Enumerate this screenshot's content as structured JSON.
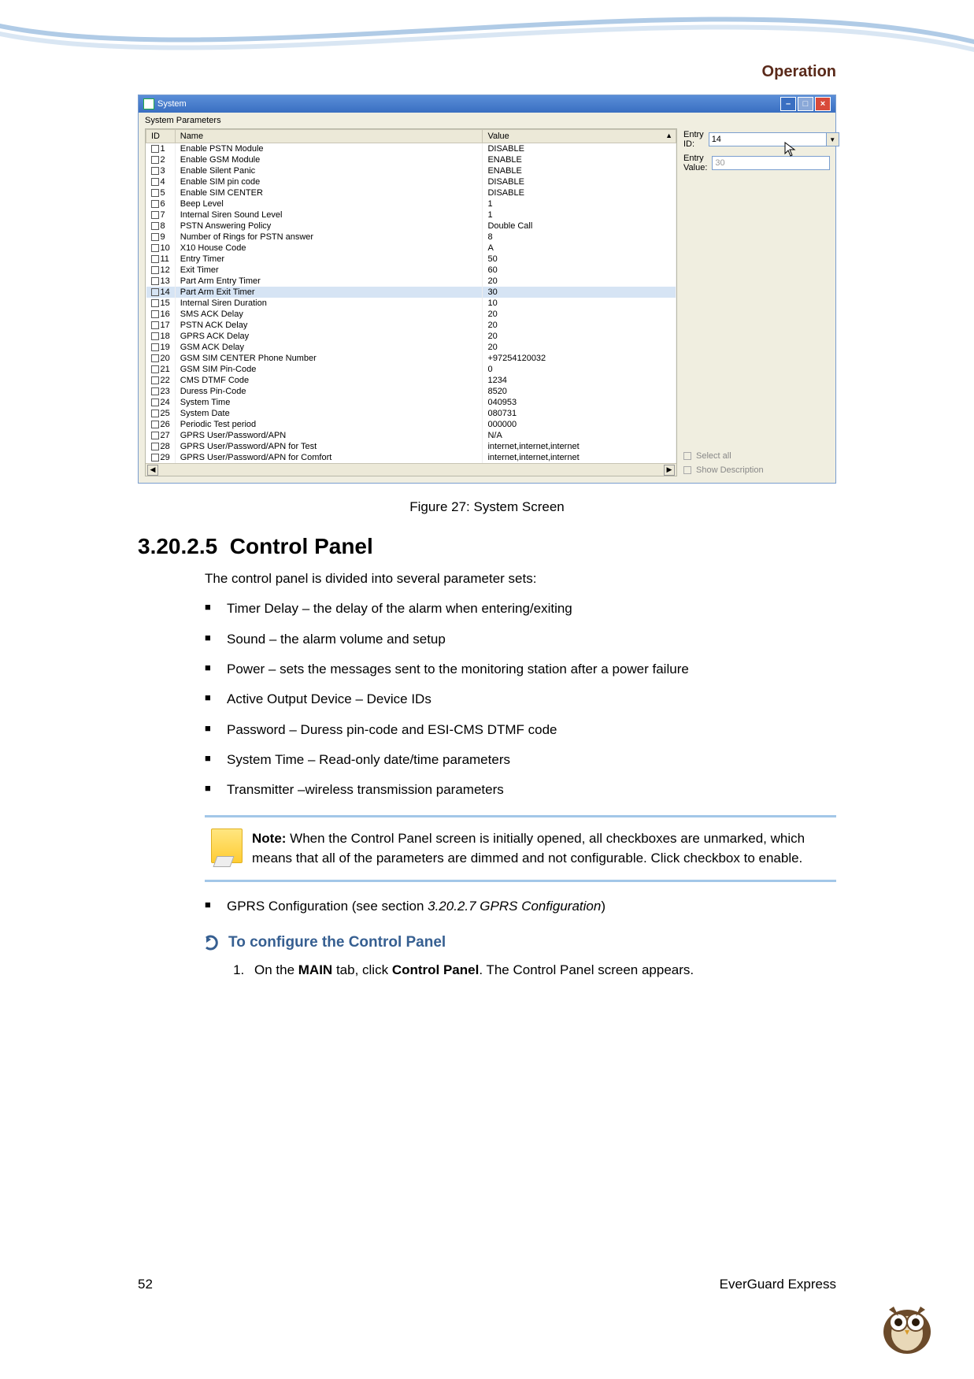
{
  "header": {
    "title": "Operation"
  },
  "window": {
    "title": "System",
    "fieldset_label": "System Parameters",
    "columns": {
      "id": "ID",
      "name": "Name",
      "value": "Value"
    },
    "rows": [
      {
        "id": "1",
        "name": "Enable PSTN Module",
        "value": "DISABLE"
      },
      {
        "id": "2",
        "name": "Enable GSM Module",
        "value": "ENABLE"
      },
      {
        "id": "3",
        "name": "Enable Silent Panic",
        "value": "ENABLE"
      },
      {
        "id": "4",
        "name": "Enable SIM pin code",
        "value": "DISABLE"
      },
      {
        "id": "5",
        "name": "Enable SIM CENTER",
        "value": "DISABLE"
      },
      {
        "id": "6",
        "name": "Beep Level",
        "value": "1"
      },
      {
        "id": "7",
        "name": "Internal Siren Sound Level",
        "value": "1"
      },
      {
        "id": "8",
        "name": "PSTN Answering Policy",
        "value": "Double Call"
      },
      {
        "id": "9",
        "name": "Number of Rings for PSTN answer",
        "value": "8"
      },
      {
        "id": "10",
        "name": "X10 House Code",
        "value": "A"
      },
      {
        "id": "11",
        "name": "Entry Timer",
        "value": "50"
      },
      {
        "id": "12",
        "name": "Exit Timer",
        "value": "60"
      },
      {
        "id": "13",
        "name": "Part Arm Entry Timer",
        "value": "20"
      },
      {
        "id": "14",
        "name": "Part Arm Exit Timer",
        "value": "30",
        "selected": true
      },
      {
        "id": "15",
        "name": "Internal Siren Duration",
        "value": "10"
      },
      {
        "id": "16",
        "name": "SMS ACK Delay",
        "value": "20"
      },
      {
        "id": "17",
        "name": "PSTN ACK Delay",
        "value": "20"
      },
      {
        "id": "18",
        "name": "GPRS ACK Delay",
        "value": "20"
      },
      {
        "id": "19",
        "name": "GSM ACK Delay",
        "value": "20"
      },
      {
        "id": "20",
        "name": "GSM SIM CENTER Phone Number",
        "value": "+97254120032"
      },
      {
        "id": "21",
        "name": "GSM SIM Pin-Code",
        "value": "0"
      },
      {
        "id": "22",
        "name": "CMS DTMF Code",
        "value": "1234"
      },
      {
        "id": "23",
        "name": "Duress Pin-Code",
        "value": "8520"
      },
      {
        "id": "24",
        "name": "System Time",
        "value": "040953"
      },
      {
        "id": "25",
        "name": "System Date",
        "value": "080731"
      },
      {
        "id": "26",
        "name": "Periodic Test period",
        "value": "000000"
      },
      {
        "id": "27",
        "name": "GPRS User/Password/APN",
        "value": "N/A"
      },
      {
        "id": "28",
        "name": "GPRS User/Password/APN for Test",
        "value": "internet,internet,internet"
      },
      {
        "id": "29",
        "name": "GPRS User/Password/APN for Comfort",
        "value": "internet,internet,internet"
      }
    ],
    "right": {
      "entry_id_label": "Entry ID:",
      "entry_id_value": "14",
      "entry_value_label": "Entry Value:",
      "entry_value_value": "30",
      "select_all": "Select all",
      "show_desc": "Show Description"
    }
  },
  "caption": "Figure 27: System Screen",
  "section": {
    "number": "3.20.2.5",
    "title": "Control Panel",
    "intro": "The control panel is divided into several parameter sets:",
    "bullets": [
      "Timer Delay – the delay of the alarm when entering/exiting",
      "Sound – the alarm volume and setup",
      "Power – sets the messages sent to the monitoring station after a power failure",
      "Active Output Device – Device IDs",
      "Password – Duress pin-code and ESI-CMS DTMF code",
      "System Time – Read-only date/time parameters",
      "Transmitter –wireless transmission parameters"
    ],
    "note_bold": "Note:",
    "note_text": " When the Control Panel screen is initially opened, all checkboxes are unmarked, which means that all of the parameters are dimmed and not configurable. Click checkbox to enable.",
    "gprs_prefix": "GPRS Configuration (see section ",
    "gprs_ref": "3.20.2.7 GPRS Configuration",
    "gprs_suffix": ")",
    "config_title": "To configure the Control Panel",
    "step1_pre": "On the ",
    "step1_b1": "MAIN",
    "step1_mid": " tab, click ",
    "step1_b2": "Control Panel",
    "step1_post": ". The Control Panel screen appears."
  },
  "footer": {
    "page": "52",
    "product": "EverGuard Express"
  }
}
